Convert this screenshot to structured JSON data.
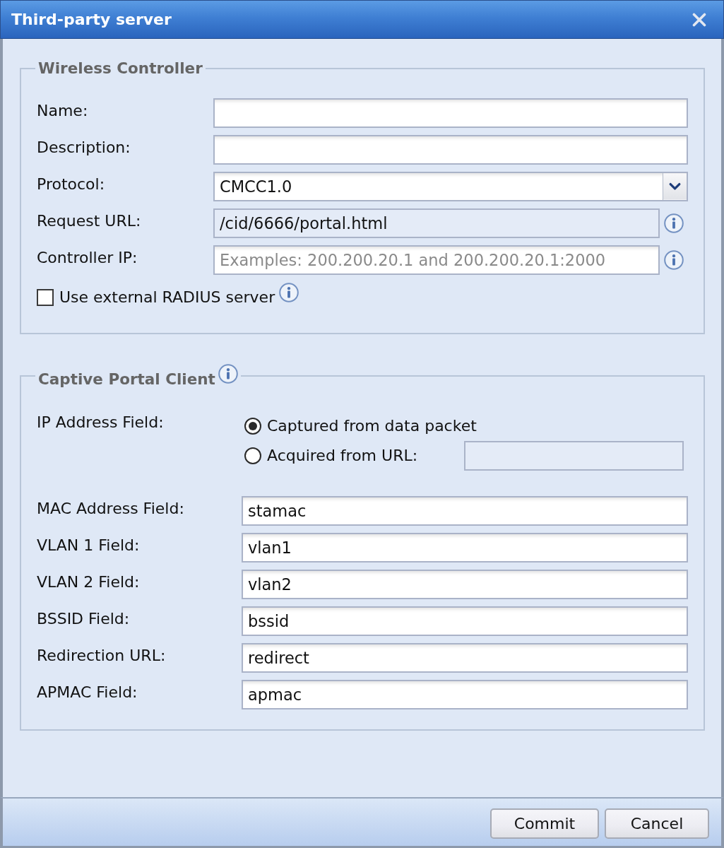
{
  "window": {
    "title": "Third-party server"
  },
  "wireless_controller": {
    "legend": "Wireless Controller",
    "fields": [
      {
        "kind": "text",
        "label": "Name:",
        "disabled": false
      },
      {
        "kind": "text",
        "label": "Description:",
        "disabled": false
      },
      {
        "kind": "select",
        "label": "Protocol:",
        "value": "CMCC1.0",
        "disabled": false
      },
      {
        "kind": "text",
        "label": "Request URL:",
        "value": "/cid/6666/portal.html",
        "disabled": true,
        "info": true
      },
      {
        "kind": "text",
        "label": "Controller IP:",
        "placeholder": "Examples: 200.200.20.1 and 200.200.20.1:2000",
        "disabled": false,
        "info": true
      }
    ],
    "radius_checkbox": {
      "label": "Use external RADIUS server",
      "checked": false,
      "info": true
    }
  },
  "captive_portal_client": {
    "legend": "Captive Portal Client",
    "info": true,
    "ip_address_field": {
      "label": "IP Address Field:",
      "options": [
        {
          "label": "Captured from data packet",
          "selected": true
        },
        {
          "label": "Acquired from URL:",
          "selected": false,
          "field": {
            "disabled": true
          }
        }
      ]
    },
    "fields": [
      {
        "label": "MAC Address Field:",
        "value": "stamac",
        "disabled": false
      },
      {
        "label": "VLAN 1 Field:",
        "value": "vlan1",
        "disabled": false
      },
      {
        "label": "VLAN 2 Field:",
        "value": "vlan2",
        "disabled": false
      },
      {
        "label": "BSSID Field:",
        "value": "bssid",
        "disabled": false
      },
      {
        "label": "Redirection URL:",
        "value": "redirect",
        "disabled": false
      },
      {
        "label": "APMAC Field:",
        "value": "apmac",
        "disabled": false
      }
    ]
  },
  "buttons": [
    {
      "label": "Commit"
    },
    {
      "label": "Cancel"
    }
  ]
}
